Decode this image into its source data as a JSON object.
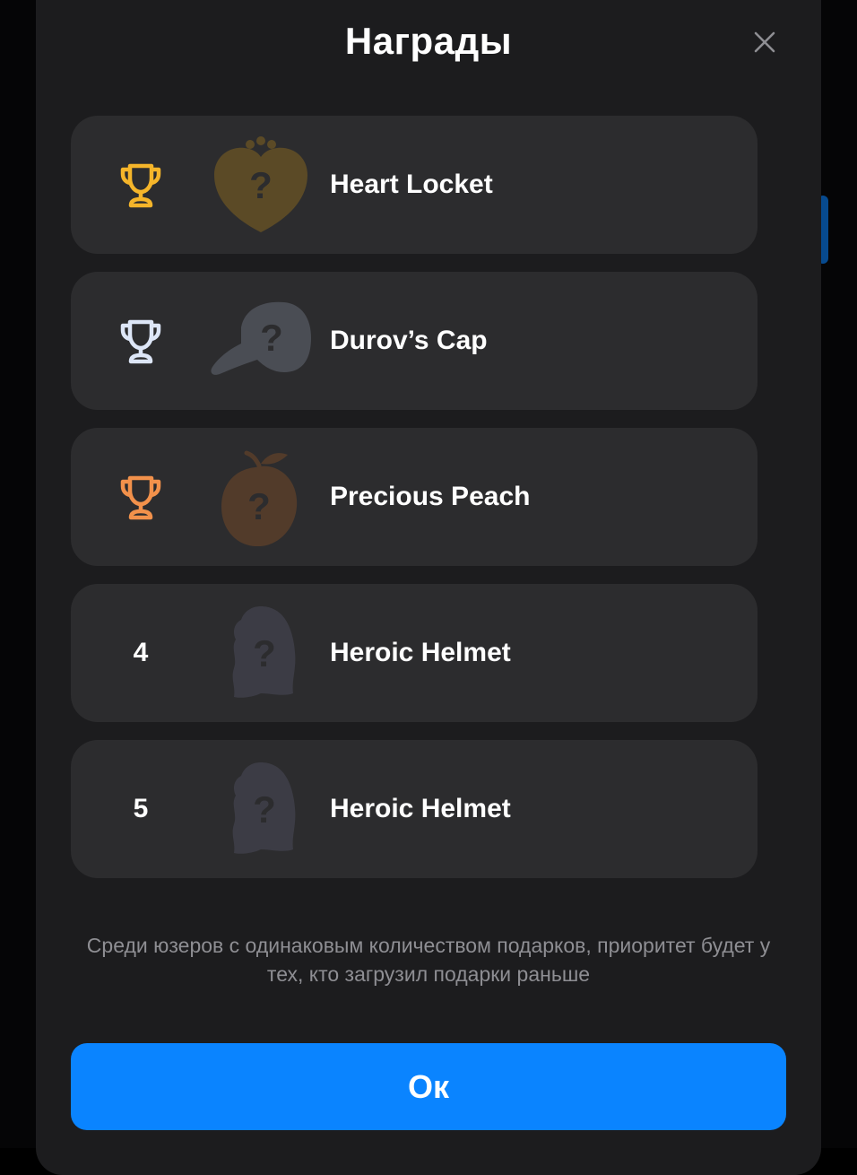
{
  "modal": {
    "title": "Награды",
    "close_icon": "close-icon"
  },
  "rewards": [
    {
      "rank_label": "",
      "rank_icon": "trophy-icon",
      "rank_color": "#f5b52a",
      "gift_icon": "heart-locket-icon",
      "gift_color": "#5b4a26",
      "name": "Heart Locket"
    },
    {
      "rank_label": "",
      "rank_icon": "trophy-icon",
      "rank_color": "#dde6f7",
      "gift_icon": "cap-icon",
      "gift_color": "#4a4d54",
      "name": "Durov’s Cap"
    },
    {
      "rank_label": "",
      "rank_icon": "trophy-icon",
      "rank_color": "#f2914b",
      "gift_icon": "peach-icon",
      "gift_color": "#523b2a",
      "name": "Precious Peach"
    },
    {
      "rank_label": "4",
      "rank_icon": "",
      "rank_color": "#ffffff",
      "gift_icon": "helmet-icon",
      "gift_color": "#3c3c45",
      "name": "Heroic Helmet"
    },
    {
      "rank_label": "5",
      "rank_icon": "",
      "rank_color": "#ffffff",
      "gift_icon": "helmet-icon",
      "gift_color": "#3c3c45",
      "name": "Heroic Helmet"
    }
  ],
  "note": "Среди юзеров с одинаковым количеством подарков, приоритет будет у тех, кто загрузил подарки раньше",
  "ok_button": {
    "label": "Ок",
    "color": "#0a84ff"
  }
}
